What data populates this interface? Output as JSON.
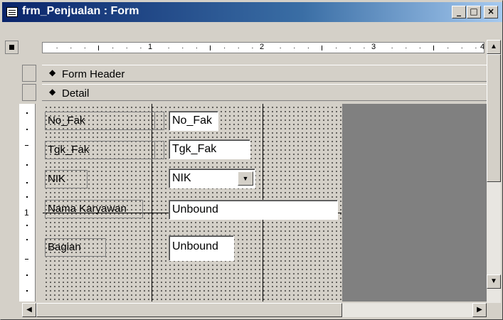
{
  "window": {
    "title": "frm_Penjualan : Form",
    "minimize_label": "_",
    "maximize_label": "□",
    "close_label": "×"
  },
  "ruler": {
    "marks": [
      "1",
      "2",
      "3",
      "4"
    ],
    "vertical_mark": "1"
  },
  "sections": {
    "form_header": "Form Header",
    "detail": "Detail"
  },
  "fields": [
    {
      "label": "No_Fak",
      "control": "No_Fak",
      "type": "textbox"
    },
    {
      "label": "Tgk_Fak",
      "control": "Tgk_Fak",
      "type": "textbox"
    },
    {
      "label": "NIK",
      "control": "NIK",
      "type": "combobox"
    },
    {
      "label": "Nama Karyawan",
      "control": "Unbound",
      "type": "textbox"
    },
    {
      "label": "Bagian",
      "control": "Unbound",
      "type": "textbox"
    }
  ],
  "scroll_glyphs": {
    "up": "▲",
    "down": "▼",
    "left": "◀",
    "right": "▶",
    "combo": "▼"
  },
  "colors": {
    "face": "#d4d0c8",
    "titlebar": "#0a246a",
    "dark_area": "#808080"
  }
}
